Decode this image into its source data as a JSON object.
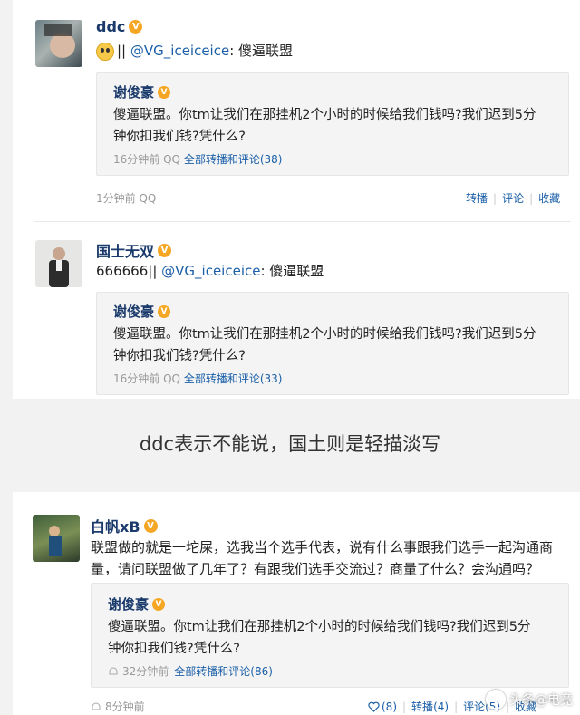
{
  "post1": {
    "username": "ddc",
    "text_prefix": "||",
    "mention": "@VG_iceiceice",
    "text_suffix": ": 傻逼联盟",
    "quote": {
      "username": "谢俊豪",
      "text": "傻逼联盟。你tm让我们在那挂机2个小时的时候给我们钱吗?我们迟到5分钟你扣我们钱?凭什么?",
      "time": "16分钟前",
      "source": "QQ",
      "reposts_label": "全部转播和评论",
      "reposts_count": "(38)"
    },
    "time": "1分钟前",
    "source": "QQ",
    "actions": {
      "repost": "转播",
      "comment": "评论",
      "favorite": "收藏"
    }
  },
  "post2": {
    "username": "国士无双",
    "text_prefix": "666666||",
    "mention": "@VG_iceiceice",
    "text_suffix": ": 傻逼联盟",
    "quote": {
      "username": "谢俊豪",
      "text": "傻逼联盟。你tm让我们在那挂机2个小时的时候给我们钱吗?我们迟到5分钟你扣我们钱?凭什么?",
      "time": "16分钟前",
      "source": "QQ",
      "reposts_label": "全部转播和评论",
      "reposts_count": "(33)"
    }
  },
  "caption": "ddc表示不能说，国土则是轻描淡写",
  "post3": {
    "username": "白帆xB",
    "text": "联盟做的就是一坨屎，选我当个选手代表，说有什么事跟我们选手一起沟通商量，请问联盟做了几年了？有跟我们选手交流过？商量了什么？会沟通吗？",
    "quote": {
      "username": "谢俊豪",
      "text": "傻逼联盟。你tm让我们在那挂机2个小时的时候给我们钱吗?我们迟到5分钟你扣我们钱?凭什么?",
      "time": "32分钟前",
      "reposts_label": "全部转播和评论",
      "reposts_count": "(86)"
    },
    "time": "8分钟前",
    "likes": "(8)",
    "repost_label": "转播",
    "repost_count": "(4)",
    "comment_label": "评论",
    "comment_count": "(5)",
    "favorite": "收藏"
  },
  "watermark": "头条@电竞"
}
